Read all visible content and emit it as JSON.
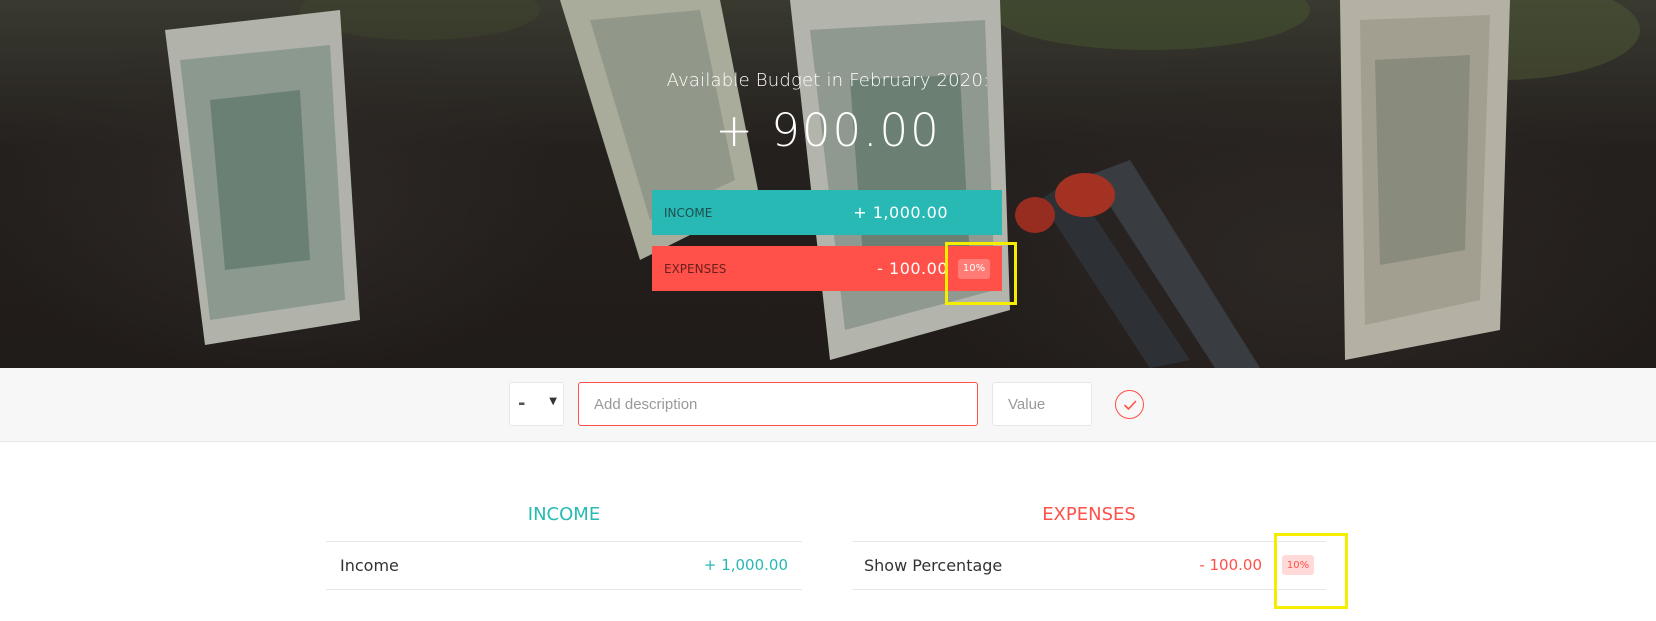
{
  "header": {
    "budget_title": "Available Budget in February 2020:",
    "budget_value": "+ 900.00",
    "income_label": "Income",
    "income_value": "+ 1,000.00",
    "expenses_label": "Expenses",
    "expenses_value": "- 100.00",
    "expenses_percentage": "10%"
  },
  "add_form": {
    "type_value": "-",
    "description_placeholder": "Add description",
    "value_placeholder": "Value"
  },
  "income_list": {
    "title": "Income",
    "items": [
      {
        "description": "Income",
        "value": "+ 1,000.00"
      }
    ]
  },
  "expenses_list": {
    "title": "Expenses",
    "items": [
      {
        "description": "Show Percentage",
        "value": "- 100.00",
        "percentage": "10%"
      }
    ]
  },
  "colors": {
    "income": "#28b9b5",
    "expenses": "#ff5049",
    "highlight": "#f5ee00"
  },
  "icons": {
    "add_button": "check-circle-icon",
    "type_select": "caret-down-icon"
  }
}
